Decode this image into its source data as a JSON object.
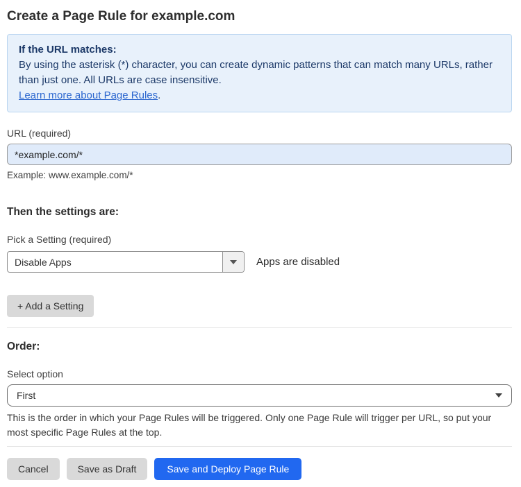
{
  "page": {
    "title": "Create a Page Rule for example.com"
  },
  "info_box": {
    "heading": "If the URL matches:",
    "body": "By using the asterisk (*) character, you can create dynamic patterns that can match many URLs, rather than just one. All URLs are case insensitive.",
    "link_text": "Learn more about Page Rules",
    "link_suffix": "."
  },
  "url_field": {
    "label": "URL (required)",
    "value": "*example.com/*",
    "helper": "Example: www.example.com/*"
  },
  "settings_section": {
    "heading": "Then the settings are:",
    "picker_label": "Pick a Setting (required)",
    "selected_setting": "Disable Apps",
    "status_text": "Apps are disabled",
    "add_button_label": "+ Add a Setting"
  },
  "order_section": {
    "heading": "Order:",
    "select_label": "Select option",
    "selected_option": "First",
    "helper": "This is the order in which your Page Rules will be triggered. Only one Page Rule will trigger per URL, so put your most specific Page Rules at the top."
  },
  "footer": {
    "cancel_label": "Cancel",
    "save_draft_label": "Save as Draft",
    "save_deploy_label": "Save and Deploy Page Rule"
  },
  "icons": {
    "setting_dropdown": "chevron-down-icon",
    "order_dropdown": "chevron-down-icon"
  },
  "colors": {
    "info_bg": "#e8f1fb",
    "info_border": "#b9d5f0",
    "info_text": "#1c3968",
    "link": "#2c67cf",
    "input_bg": "#e0ebfa",
    "gray_button": "#d9d9d9",
    "primary_button": "#2168f0"
  }
}
